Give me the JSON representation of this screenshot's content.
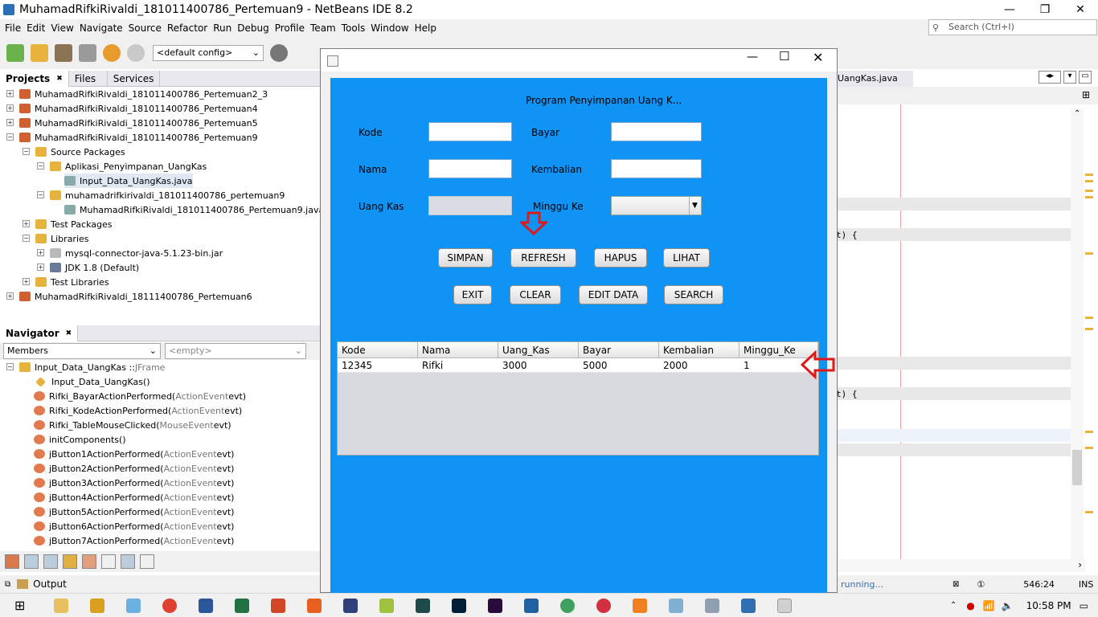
{
  "ide": {
    "window_title": "MuhamadRifkiRivaldi_181011400786_Pertemuan9 - NetBeans IDE 8.2",
    "menu": [
      "File",
      "Edit",
      "View",
      "Navigate",
      "Source",
      "Refactor",
      "Run",
      "Debug",
      "Profile",
      "Team",
      "Tools",
      "Window",
      "Help"
    ],
    "config": "<default config>",
    "search_placeholder": "Search (Ctrl+I)",
    "panel_tabs": [
      "Projects",
      "Files",
      "Services"
    ],
    "tree": [
      "MuhamadRifkiRivaldi_181011400786_Pertemuan2_3",
      "MuhamadRifkiRivaldi_181011400786_Pertemuan4",
      "MuhamadRifkiRivaldi_181011400786_Pertemuan5",
      "MuhamadRifkiRivaldi_181011400786_Pertemuan9",
      "Source Packages",
      "Aplikasi_Penyimpanan_UangKas",
      "Input_Data_UangKas.java",
      "muhamadrifkirivaldi_181011400786_pertemuan9",
      "MuhamadRifkiRivaldi_181011400786_Pertemuan9.java",
      "Test Packages",
      "Libraries",
      "mysql-connector-java-5.1.23-bin.jar",
      "JDK 1.8 (Default)",
      "Test Libraries",
      "MuhamadRifkiRivaldi_18111400786_Pertemuan6"
    ],
    "navigator_title": "Navigator",
    "members_select": "Members",
    "empty_select": "<empty>",
    "nav_root": "Input_Data_UangKas :: ",
    "nav_root_type": "JFrame",
    "nav_items": [
      {
        "name": "Input_Data_UangKas()",
        "arg": "",
        "p": ""
      },
      {
        "name": "Rifki_BayarActionPerformed(",
        "arg": "ActionEvent",
        "p": " evt)"
      },
      {
        "name": "Rifki_KodeActionPerformed(",
        "arg": "ActionEvent",
        "p": " evt)"
      },
      {
        "name": "Rifki_TableMouseClicked(",
        "arg": "MouseEvent",
        "p": " evt)"
      },
      {
        "name": "initComponents()",
        "arg": "",
        "p": ""
      },
      {
        "name": "jButton1ActionPerformed(",
        "arg": "ActionEvent",
        "p": " evt)"
      },
      {
        "name": "jButton2ActionPerformed(",
        "arg": "ActionEvent",
        "p": " evt)"
      },
      {
        "name": "jButton3ActionPerformed(",
        "arg": "ActionEvent",
        "p": " evt)"
      },
      {
        "name": "jButton4ActionPerformed(",
        "arg": "ActionEvent",
        "p": " evt)"
      },
      {
        "name": "jButton5ActionPerformed(",
        "arg": "ActionEvent",
        "p": " evt)"
      },
      {
        "name": "jButton6ActionPerformed(",
        "arg": "ActionEvent",
        "p": " evt)"
      },
      {
        "name": "jButton7ActionPerformed(",
        "arg": "ActionEvent",
        "p": " evt)"
      }
    ],
    "output_label": "Output",
    "editor_tab": "UangKas.java",
    "code_lines": [
      "t) {",
      "t) {"
    ],
    "status_running": "running...",
    "cursor_pos": "546:24",
    "ins": "INS"
  },
  "app": {
    "title": "Program Penyimpanan Uang K...",
    "labels": {
      "kode": "Kode",
      "bayar": "Bayar",
      "nama": "Nama",
      "kembalian": "Kembalian",
      "uang_kas": "Uang Kas",
      "minggu_ke": "Minggu Ke"
    },
    "buttons": {
      "simpan": "SIMPAN",
      "refresh": "REFRESH",
      "hapus": "HAPUS",
      "lihat": "LIHAT",
      "exit": "EXIT",
      "clear": "CLEAR",
      "edit": "EDIT DATA",
      "search": "SEARCH"
    },
    "table": {
      "columns": [
        "Kode",
        "Nama",
        "Uang_Kas",
        "Bayar",
        "Kembalian",
        "Minggu_Ke"
      ],
      "rows": [
        [
          "12345",
          "Rifki",
          "3000",
          "5000",
          "2000",
          "1"
        ]
      ]
    }
  },
  "taskbar": {
    "clock": "10:58 PM"
  },
  "colors": {
    "panel": "#0f93f5",
    "arrow": "#e01818"
  }
}
